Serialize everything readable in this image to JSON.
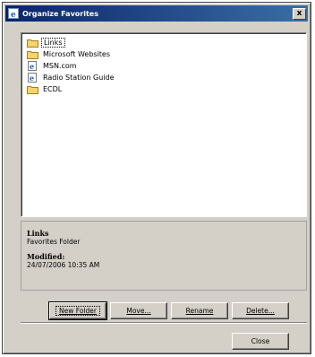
{
  "window": {
    "title": "Organize Favorites",
    "close_glyph": "x"
  },
  "favorites": [
    {
      "label": "Links",
      "icon": "folder-icon",
      "selected": true
    },
    {
      "label": "Microsoft Websites",
      "icon": "folder-icon",
      "selected": false
    },
    {
      "label": "MSN.com",
      "icon": "ie-page-icon",
      "selected": false
    },
    {
      "label": "Radio Station Guide",
      "icon": "ie-page-icon",
      "selected": false
    },
    {
      "label": "ECDL",
      "icon": "folder-icon",
      "selected": false
    }
  ],
  "details": {
    "name": "Links",
    "type": "Favorites Folder",
    "modified_label": "Modified:",
    "modified_value": "24/07/2006 10:35 AM"
  },
  "buttons": {
    "new_folder": "New Folder",
    "move": "Move...",
    "rename": "Rename",
    "delete": "Delete...",
    "close": "Close"
  },
  "colors": {
    "title_start": "#0a246a",
    "title_end": "#3a6ea5",
    "face": "#d4d0c8"
  }
}
